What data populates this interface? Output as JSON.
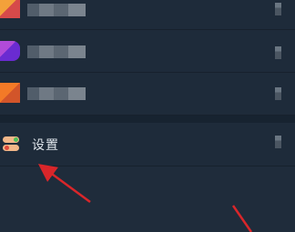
{
  "list": {
    "items": [
      {
        "icon": "blurred-app-avatar-orange"
      },
      {
        "icon": "blurred-app-avatar-purple"
      },
      {
        "icon": "blurred-app-avatar-orange-red"
      }
    ],
    "settings": {
      "label": "设置",
      "icon": "toggle-switches-icon"
    }
  },
  "colors": {
    "background": "#1f2c3b",
    "row": "#1e2b3a",
    "annotation_arrow": "#d9262a",
    "toggle_on": "#4fbf58",
    "toggle_off": "#e04a3c"
  }
}
